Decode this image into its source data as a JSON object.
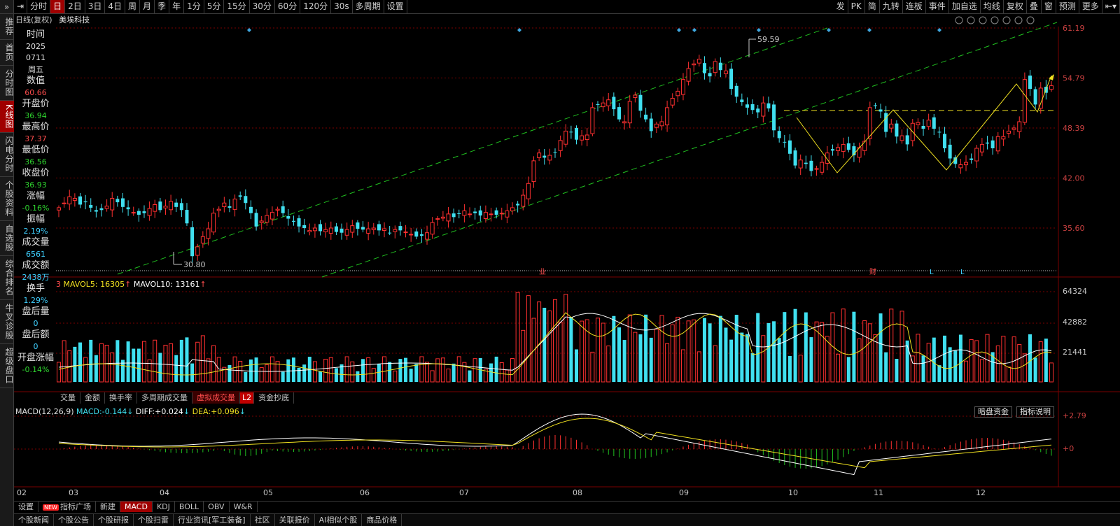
{
  "toolbar": {
    "items": [
      "分时",
      "日",
      "2日",
      "3日",
      "4日",
      "周",
      "月",
      "季",
      "年",
      "1分",
      "5分",
      "15分",
      "30分",
      "60分",
      "120分",
      "30s",
      "多周期",
      "设置"
    ],
    "active": "日",
    "right_items": [
      "发",
      "PK",
      "简",
      "九转",
      "连板",
      "事件",
      "加自选",
      "均线",
      "复权",
      "叠",
      "窗",
      "预测",
      "更多"
    ]
  },
  "leftnav": {
    "top": "»",
    "items": [
      "推荐",
      "首页",
      "分时图",
      "K线图",
      "闪电分时",
      "个股资料",
      "自选股",
      "综合排名",
      "牛叉诊股",
      "超级盘口"
    ],
    "active": "K线图"
  },
  "title": {
    "period": "日线(复权)",
    "stock_name": "美埃科技"
  },
  "info_panel": [
    {
      "label": "时间",
      "value": "2025",
      "value2": "0711",
      "value3": "周五"
    },
    {
      "label": "数值",
      "value": "60.66",
      "color": "red"
    },
    {
      "label": "开盘价",
      "value": "36.94",
      "color": "green"
    },
    {
      "label": "最高价",
      "value": "37.37",
      "color": "red"
    },
    {
      "label": "最低价",
      "value": "36.56",
      "color": "green"
    },
    {
      "label": "收盘价",
      "value": "36.93",
      "color": "green"
    },
    {
      "label": "涨幅",
      "value": "-0.16%",
      "color": "green"
    },
    {
      "label": "振幅",
      "value": "2.19%",
      "color": "cyan"
    },
    {
      "label": "成交量",
      "value": "6561",
      "color": "cyan"
    },
    {
      "label": "成交额",
      "value": "2438万",
      "color": "cyan"
    },
    {
      "label": "换手",
      "value": "1.29%",
      "color": "cyan"
    },
    {
      "label": "盘后量",
      "value": "0",
      "color": "cyan"
    },
    {
      "label": "盘后额",
      "value": "0",
      "color": "cyan"
    },
    {
      "label": "开盘涨幅",
      "value": "-0.14%",
      "color": "green"
    }
  ],
  "price_axis": [
    "61.19",
    "54.79",
    "48.39",
    "42.00",
    "35.60"
  ],
  "price_annotations": {
    "high": "59.59",
    "low": "30.80"
  },
  "event_markers": [
    "业",
    "财",
    "L",
    "L"
  ],
  "volume_header": {
    "prefix": "3",
    "mavol5_label": "MAVOL5:",
    "mavol5": "16305",
    "mavol10_label": "MAVOL10:",
    "mavol10": "13161"
  },
  "volume_axis": [
    "64324",
    "42882",
    "21441"
  ],
  "indicator_tabs": [
    "交量",
    "金额",
    "换手率",
    "多周期成交量",
    "虚拟成交量",
    "L2",
    "资金抄底"
  ],
  "indicator_active": "虚拟成交量",
  "macd_header": {
    "name": "MACD(12,26,9)",
    "macd_label": "MACD:",
    "macd": "-0.144",
    "diff_label": "DIFF:",
    "diff": "+0.024",
    "dea_label": "DEA:",
    "dea": "+0.096"
  },
  "macd_buttons": [
    "暗盘资金",
    "指标说明"
  ],
  "macd_axis": [
    "2.79",
    "0"
  ],
  "x_axis": [
    "02",
    "03",
    "04",
    "05",
    "06",
    "07",
    "08",
    "09",
    "10",
    "11",
    "12"
  ],
  "bottom_tabs": [
    "设置",
    "指标广场",
    "新建",
    "MACD",
    "KDJ",
    "BOLL",
    "OBV",
    "W&R"
  ],
  "bottom_active": "MACD",
  "new_badge": "NEW",
  "news_tabs": [
    "个股新闻",
    "个股公告",
    "个股研报",
    "个股扫雷",
    "行业资讯[军工装备]",
    "社区",
    "关联报价",
    "AI相似个股",
    "商品价格"
  ],
  "colors": {
    "up": "#ff3030",
    "down": "#40e0f0",
    "ma5": "#ffffff",
    "ma10": "#f0e020",
    "grid": "#7a0000",
    "channel": "#20c020"
  },
  "chart_data": {
    "type": "candlestick",
    "description_values": {
      "closes": [
        38.2,
        38.8,
        39.6,
        39.4,
        38.6,
        38.9,
        38.2,
        37.7,
        37.9,
        38.4,
        39.4,
        38.9,
        38.3,
        38.0,
        37.6,
        37.3,
        37.5,
        38.1,
        38.6,
        37.9,
        38.4,
        39.0,
        38.3,
        37.9,
        36.2,
        32.0,
        33.2,
        34.5,
        35.5,
        37.5,
        38.0,
        38.8,
        38.2,
        39.3,
        39.6,
        38.8,
        37.5,
        35.8,
        36.5,
        37.2,
        37.6,
        38.0,
        37.5,
        36.8,
        36.4,
        35.8,
        35.6,
        35.3,
        35.6,
        35.2,
        35.4,
        35.6,
        35.1,
        35.0,
        35.4,
        35.9,
        35.5,
        35.4,
        35.5,
        35.6,
        35.3,
        35.5,
        35.0,
        35.4,
        35.3,
        35.1,
        34.8,
        34.5,
        34.6,
        35.0,
        36.3,
        36.8,
        37.0,
        37.4,
        37.0,
        37.4,
        37.8,
        37.4,
        37.5,
        37.2,
        37.6,
        37.4,
        37.3,
        37.5,
        37.8,
        38.2,
        38.5,
        39.8,
        41.3,
        44.2,
        45.2,
        44.6,
        44.9,
        45.3,
        46.8,
        48.0,
        47.9,
        46.9,
        47.4,
        47.5,
        51.0,
        51.4,
        51.6,
        52.0,
        50.8,
        49.5,
        49.2,
        51.8,
        52.6,
        50.6,
        49.5,
        48.0,
        48.9,
        49.2,
        51.0,
        52.2,
        53.1,
        54.6,
        56.0,
        56.6,
        57.2,
        55.4,
        55.0,
        56.9,
        55.8,
        55.7,
        53.4,
        52.4,
        51.7,
        51.0,
        50.7,
        50.4,
        51.6,
        50.9,
        48.1,
        47.1,
        46.6,
        45.1,
        43.6,
        44.3,
        43.8,
        42.9,
        43.2,
        44.0,
        45.2,
        45.5,
        45.9,
        46.3,
        45.6,
        44.9,
        45.9,
        46.7,
        51.0,
        51.2,
        50.5,
        47.9,
        48.9,
        47.3,
        47.4,
        46.3,
        49.0,
        49.1,
        48.3,
        49.4,
        48.3,
        47.9,
        45.8,
        44.5,
        43.8,
        43.7,
        44.0,
        44.3,
        45.8,
        46.3,
        46.4,
        45.8,
        47.3,
        47.3,
        48.0,
        48.4,
        49.2,
        54.6,
        53.4,
        51.4,
        53.5,
        52.9,
        53.8
      ]
    }
  }
}
